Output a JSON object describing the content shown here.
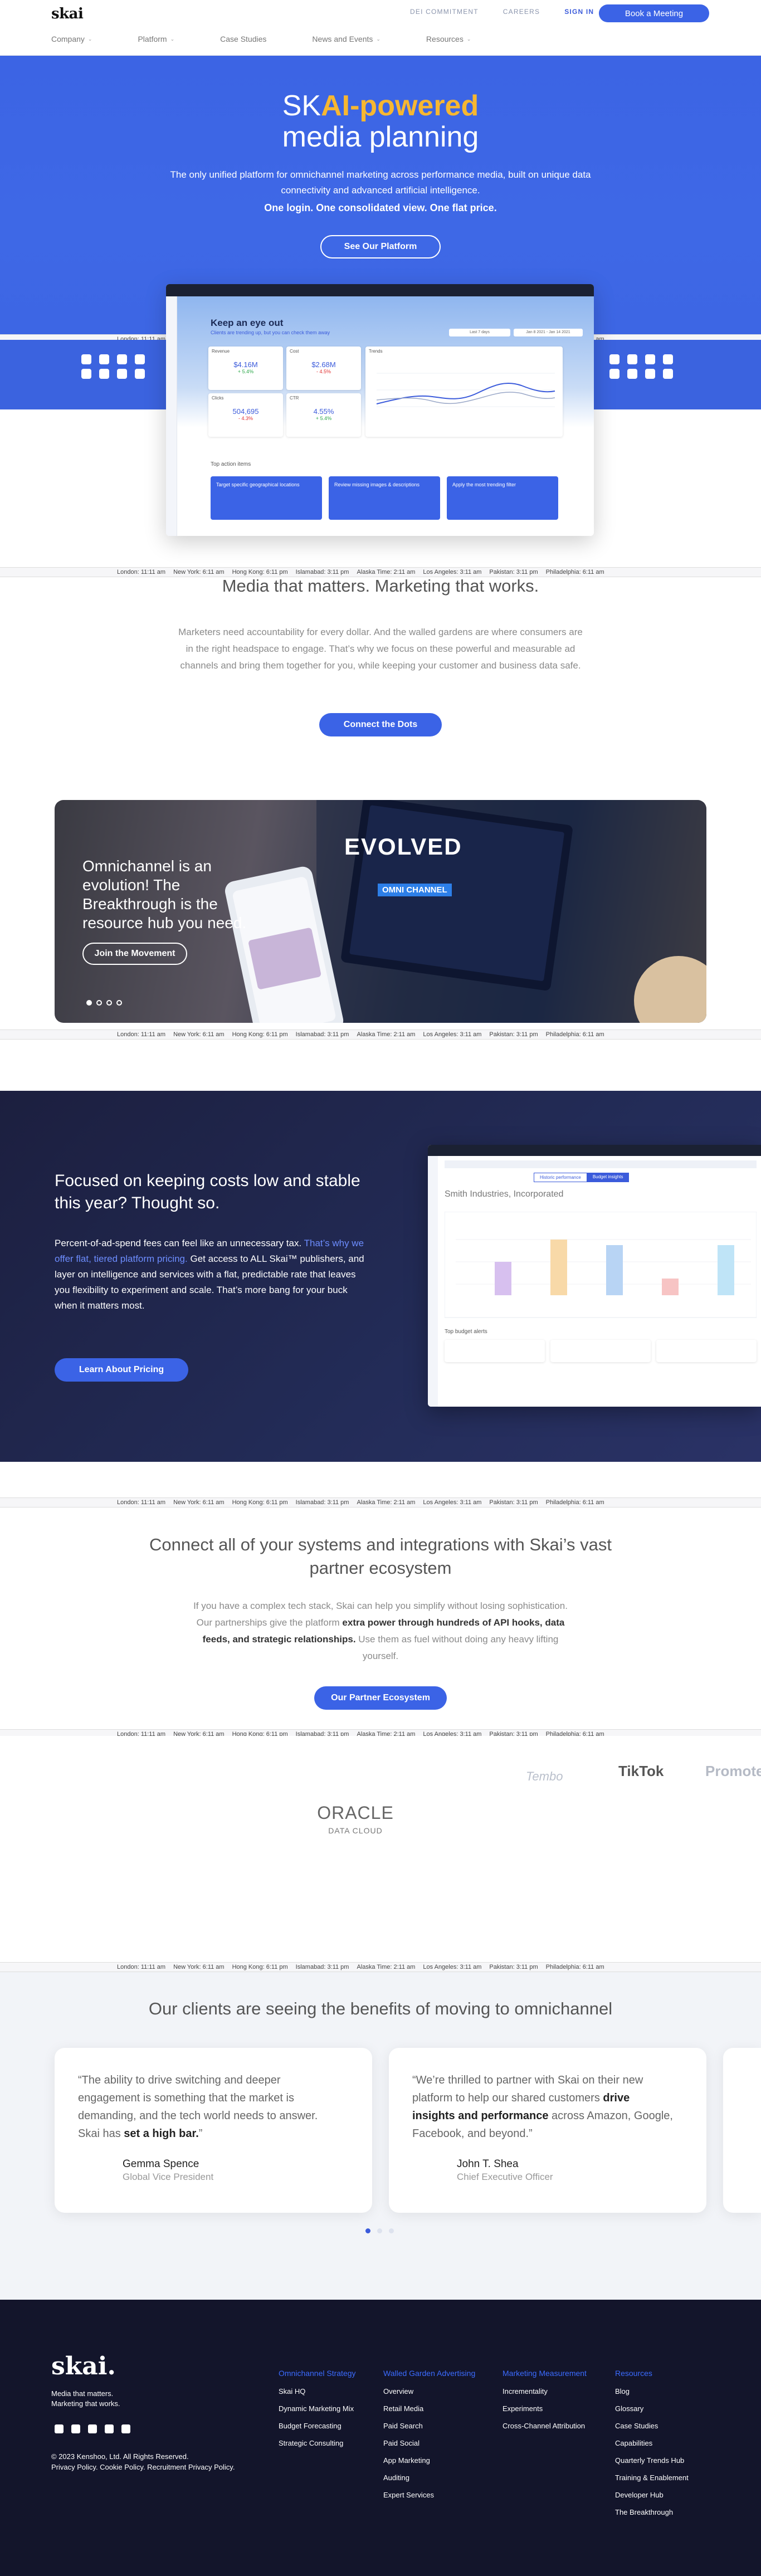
{
  "header": {
    "logo": "skai",
    "top_links": [
      "DEI COMMITMENT",
      "CAREERS"
    ],
    "sign_in": "SIGN IN",
    "cta": "Book a Meeting",
    "nav": [
      "Company",
      "Platform",
      "Case Studies",
      "News and Events",
      "Resources"
    ]
  },
  "hero": {
    "title_part1": "SK",
    "title_accent": "AI-powered",
    "title_line2": "media planning",
    "body": "The only unified platform for omnichannel marketing across performance media, built on unique data connectivity and advanced artificial intelligence.",
    "bold": "One login. One consolidated view. One flat price.",
    "button": "See Our Platform"
  },
  "ticker": [
    "London: 11:11 am",
    "New York: 6:11 am",
    "Hong Kong: 6:11 pm",
    "Islamabad: 3:11 pm",
    "Alaska Time: 2:11 am",
    "Los Angeles: 3:11 am",
    "Pakistan: 3:11 pm",
    "Philadelphia: 6:11 am"
  ],
  "dashboard": {
    "title": "Keep an eye out",
    "subtitle": "Clients are trending up, but you can check them away",
    "date1": "Last 7 days",
    "date2": "Jan 8 2021 - Jan 14 2021",
    "kpis": [
      {
        "label": "Revenue",
        "value": "$4.16M",
        "change": "+ 5.4%"
      },
      {
        "label": "Cost",
        "value": "$2.68M",
        "change": "- 4.5%"
      },
      {
        "label": "Clicks",
        "value": "504,695",
        "change": "- 4.3%"
      },
      {
        "label": "CTR",
        "value": "4.55%",
        "change": "+ 5.4%"
      }
    ],
    "trends": "Trends",
    "top_action": "Top action items",
    "actions": [
      "Target specific geographical locations",
      "Review missing images & descriptions",
      "Apply the most trending filter"
    ]
  },
  "media": {
    "title": "Media that matters. Marketing that works.",
    "body": "Marketers need accountability for every dollar. And the walled gardens are where consumers are in the right headspace to engage. That’s why we focus on these powerful and measurable ad channels and bring them together for you, while keeping your customer and business data safe.",
    "button": "Connect the Dots"
  },
  "omni": {
    "title": "Omnichannel is an evolution! The Breakthrough is the resource hub you need.",
    "button": "Join the Movement",
    "art_text": "EVOLVED",
    "art_text2": "OMNI CHANNEL"
  },
  "pricing": {
    "title": "Focused on keeping costs low and stable this year? Thought so.",
    "body1": "Percent-of-ad-spend fees can feel like an unnecessary tax.",
    "body_blue": "That’s why we offer flat, tiered platform pricing.",
    "body2": "Get access to ALL Skai™ publishers, and layer on intelligence and services with a flat, predictable rate that leaves you flexibility to experiment and scale. That’s more bang for your buck when it matters most.",
    "button": "Learn About Pricing",
    "shot_title": "Smith Industries, Incorporated",
    "shot_tab1": "Historic performance",
    "shot_tab2": "Budget insights",
    "shot_alerts": "Top budget alerts"
  },
  "partners": {
    "title": "Connect all of your systems and integrations with Skai’s vast partner ecosystem",
    "body1": "If you have a complex tech stack, Skai can help you simplify without losing sophistication. Our partnerships give the platform",
    "body_bold": "extra power through hundreds of API hooks, data feeds, and strategic relationships.",
    "body2": "Use them as fuel without doing any heavy lifting yourself.",
    "button": "Our Partner Ecosystem"
  },
  "logos": [
    "Tembo",
    "TikTok",
    "Promote",
    "ORACLE",
    "DATA CLOUD"
  ],
  "clients": {
    "title": "Our clients are seeing the benefits of moving to omnichannel",
    "quotes": [
      {
        "pre": "“The ability to drive switching and deeper engagement is something that the market is demanding, and the tech world needs to answer. Skai has ",
        "bold": "set a high bar.",
        "post": "”",
        "name": "Gemma Spence",
        "role": "Global Vice President"
      },
      {
        "pre": "“We’re thrilled to partner with Skai on their new platform to help our shared customers ",
        "bold": "drive insights and performance",
        "post": " across Amazon, Google, Facebook, and beyond.”",
        "name": "John T. Shea",
        "role": "Chief Executive Officer"
      }
    ]
  },
  "footer": {
    "logo": "skai.",
    "tag1": "Media that matters.",
    "tag2": "Marketing that works.",
    "copyright": "© 2023 Kenshoo, Ltd. All Rights Reserved.",
    "policies": "Privacy Policy. Cookie Policy. Recruitment Privacy Policy.",
    "columns": [
      {
        "head": "Omnichannel Strategy",
        "items": [
          "Skai HQ",
          "Dynamic Marketing Mix",
          "Budget Forecasting",
          "Strategic Consulting"
        ]
      },
      {
        "head": "Walled Garden Advertising",
        "items": [
          "Overview",
          "Retail Media",
          "Paid Search",
          "Paid Social",
          "App Marketing",
          "Auditing",
          "Expert Services"
        ]
      },
      {
        "head": "Marketing Measurement",
        "items": [
          "Incrementality",
          "Experiments",
          "Cross-Channel Attribution"
        ]
      },
      {
        "head": "Resources",
        "items": [
          "Blog",
          "Glossary",
          "Case Studies",
          "Capabilities",
          "Quarterly Trends Hub",
          "Training & Enablement",
          "Developer Hub",
          "The Breakthrough"
        ]
      }
    ]
  }
}
